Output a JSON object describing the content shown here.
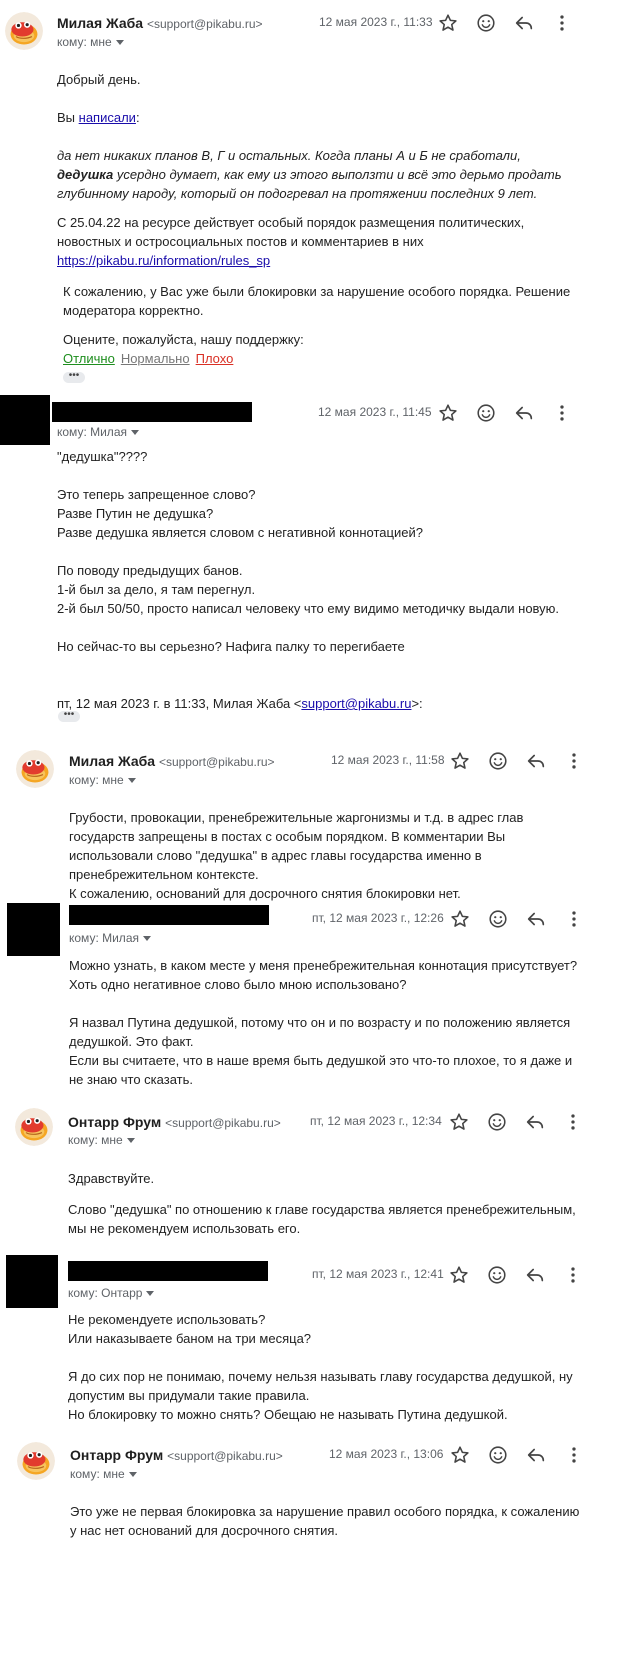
{
  "messages": [
    {
      "sender_name": "Милая Жаба",
      "sender_addr": "<support@pikabu.ru>",
      "to": "кому: мне",
      "date": "12 мая 2023 г., 11:33",
      "greeting": "Добрый день.",
      "wrote_prefix": "Вы",
      "wrote_link": "написали",
      "wrote_suffix": ":",
      "quote_1": "да нет никаких планов В, Г и остальных. Когда планы А и Б не сработали,",
      "quote_bold": "дедушка",
      "quote_2": "усердно думает, как ему из этого выползти и всё это дерьмо продать глубинному народу, который он подогревал на протяжении последних 9 лет.",
      "rules_text": "С 25.04.22 на ресурсе действует особый порядок размещения политических, новостных и остросоциальных постов и комментариев в них",
      "rules_link": "https://pikabu.ru/information/rules_sp",
      "block_text": "К сожалению, у Вас уже были блокировки за нарушение особого порядка. Решение модератора корректно.",
      "rate_prompt": "Оцените, пожалуйста, нашу поддержку:",
      "rate_good": "Отлично",
      "rate_ok": "Нормально",
      "rate_bad": "Плохо",
      "rate_good_color": "#1e8e1e",
      "rate_ok_color": "#777777",
      "rate_bad_color": "#d93025"
    },
    {
      "to": "кому: Милая",
      "date": "12 мая 2023 г., 11:45",
      "line_1": "\"дедушка\"????",
      "line_2": "Это теперь запрещенное слово?",
      "line_3": "Разве Путин не дедушка?",
      "line_4": "Разве дедушка является словом с негативной коннотацией?",
      "line_5": "По поводу предыдущих банов.",
      "line_6": "1-й был за дело, я там перегнул.",
      "line_7": "2-й был 50/50, просто написал человеку что ему видимо методичку выдали новую.",
      "line_8": "Но сейчас-то вы серьезно? Нафига палку то перегибаете",
      "quote_header_prefix": "пт, 12 мая 2023 г. в 11:33, Милая Жаба <",
      "quote_header_link": "support@pikabu.ru",
      "quote_header_suffix": ">:"
    },
    {
      "sender_name": "Милая Жаба",
      "sender_addr": "<support@pikabu.ru>",
      "to": "кому: мне",
      "date": "12 мая 2023 г., 11:58",
      "text": "Грубости, провокации, пренебрежительные жаргонизмы и т.д. в адрес глав государств запрещены в постах с особым порядком. В комментарии Вы использовали слово \"дедушка\" в адрес главы государства именно в пренебрежительном контексте.",
      "text_2": "К сожалению, оснований для досрочного снятия блокировки нет."
    },
    {
      "to": "кому: Милая",
      "date": "пт, 12 мая 2023 г., 12:26",
      "line_1": "Можно узнать, в каком месте у меня пренебрежительная коннотация присутствует? Хоть одно негативное слово было мною использовано?",
      "line_2": "Я назвал Путина дедушкой, потому что он и по возрасту и по положению является дедушкой. Это факт.",
      "line_3": "Если вы считаете, что в наше время быть дедушкой это что-то плохое, то я даже и не знаю что сказать."
    },
    {
      "sender_name": "Онтарр Фрум",
      "sender_addr": "<support@pikabu.ru>",
      "to": "кому: мне",
      "date": "пт, 12 мая 2023 г., 12:34",
      "line_1": "Здравствуйте.",
      "line_2": "Слово \"дедушка\" по отношению к главе государства является пренебрежительным, мы не рекомендуем использовать его."
    },
    {
      "to": "кому: Онтарр",
      "date": "пт, 12 мая 2023 г., 12:41",
      "line_1": "Не рекомендуете использовать?",
      "line_2": "Или наказываете баном на три месяца?",
      "line_3": "Я до сих пор не понимаю, почему нельзя называть главу государства дедушкой, ну допустим вы придумали такие правила.",
      "line_4": "Но блокировку то можно снять? Обещаю не называть Путина дедушкой."
    },
    {
      "sender_name": "Онтарр Фрум",
      "sender_addr": "<support@pikabu.ru>",
      "to": "кому: мне",
      "date": "12 мая 2023 г., 13:06",
      "text": "Это уже не первая блокировка за нарушение правил особого порядка, к сожалению у нас нет оснований для досрочного снятия."
    }
  ],
  "icons": [
    "star-icon",
    "emoji-icon",
    "reply-icon",
    "more-vert-icon"
  ],
  "colors": {
    "link": "#1a0dab",
    "secondary_text": "#5f6368"
  }
}
